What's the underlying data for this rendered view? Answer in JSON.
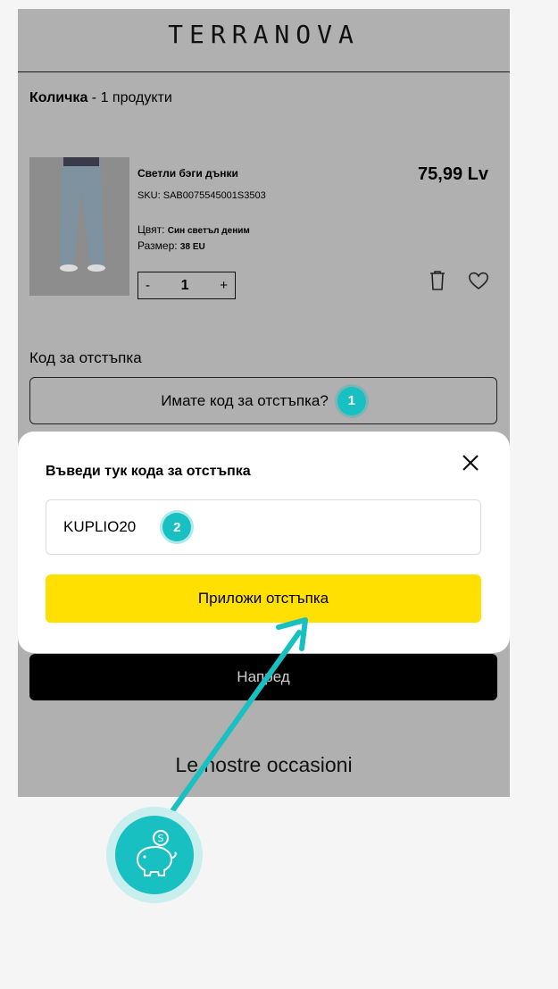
{
  "header": {
    "logo": "TERRANOVA"
  },
  "cart": {
    "title": "Количка",
    "count_text": " - 1 продукти"
  },
  "product": {
    "name": "Светли бэги дънки",
    "sku": "SKU: SAB0075545001S3503",
    "color_label": "Цвят: ",
    "color_value": "Син светъл деним",
    "size_label": "Размер: ",
    "size_value": "38 EU",
    "price": "75,99 Lv",
    "quantity": "1",
    "qty_minus": "-",
    "qty_plus": "+"
  },
  "discount": {
    "section_label": "Код за отстъпка",
    "toggle_label": "Имате код за отстъпка?",
    "step1": "1"
  },
  "next_button": "Напред",
  "footer_text": "Le nostre occasioni",
  "modal": {
    "title": "Въведи тук кода за отстъпка",
    "code_value": "KUPLIO20",
    "step2": "2",
    "apply_label": "Приложи отстъпка"
  },
  "colors": {
    "accent": "#19c0c2",
    "apply_button": "#ffe000",
    "overlay": "#b0b0b0"
  },
  "icons": [
    "close-icon",
    "trash-icon",
    "heart-icon",
    "piggy-bank-icon",
    "arrow-icon"
  ]
}
